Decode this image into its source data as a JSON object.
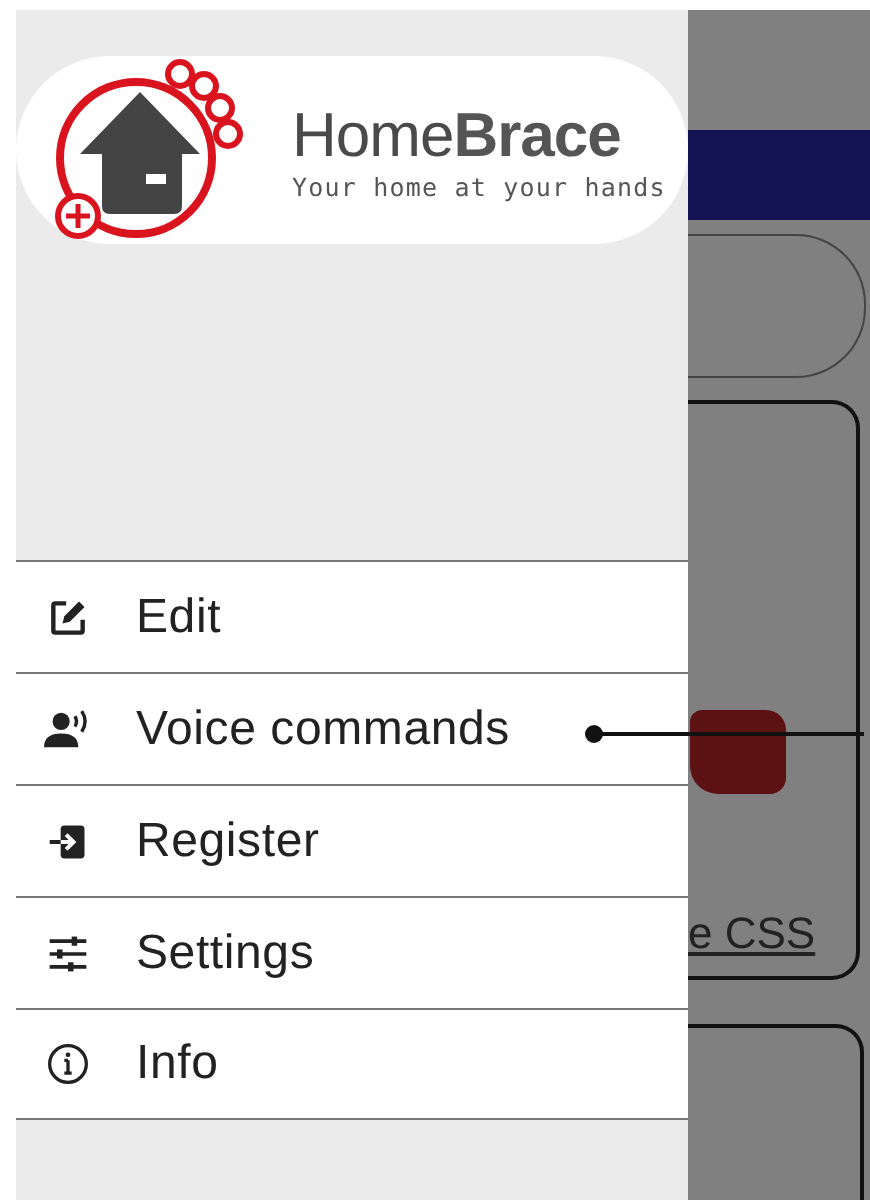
{
  "drawer": {
    "logo": {
      "name_light": "Home",
      "name_bold": "Brace",
      "tagline": "Your home at your hands"
    },
    "menu": [
      {
        "label": "Edit"
      },
      {
        "label": "Voice commands"
      },
      {
        "label": "Register"
      },
      {
        "label": "Settings"
      },
      {
        "label": "Info"
      }
    ]
  },
  "background": {
    "link_text": "e CSS"
  }
}
